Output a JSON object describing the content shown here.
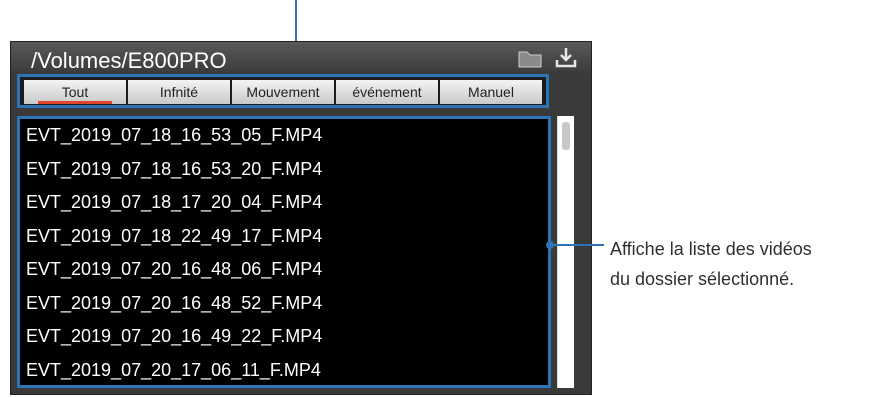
{
  "window": {
    "path_title": "/Volumes/E800PRO"
  },
  "toolbar": {
    "icons": [
      "folder-icon",
      "download-icon"
    ]
  },
  "tabs": [
    {
      "label": "Tout",
      "active": true
    },
    {
      "label": "Infnité",
      "active": false
    },
    {
      "label": "Mouvement",
      "active": false
    },
    {
      "label": "événement",
      "active": false
    },
    {
      "label": "Manuel",
      "active": false
    }
  ],
  "files": [
    "EVT_2019_07_18_16_53_05_F.MP4",
    "EVT_2019_07_18_16_53_20_F.MP4",
    "EVT_2019_07_18_17_20_04_F.MP4",
    "EVT_2019_07_18_22_49_17_F.MP4",
    "EVT_2019_07_20_16_48_06_F.MP4",
    "EVT_2019_07_20_16_48_52_F.MP4",
    "EVT_2019_07_20_16_49_22_F.MP4",
    "EVT_2019_07_20_17_06_11_F.MP4"
  ],
  "callout": {
    "line1": "Affiche la liste des vidéos",
    "line2": "du dossier sélectionné."
  },
  "colors": {
    "accent": "#2b74b8",
    "active_tab_underline": "#e0442a"
  }
}
